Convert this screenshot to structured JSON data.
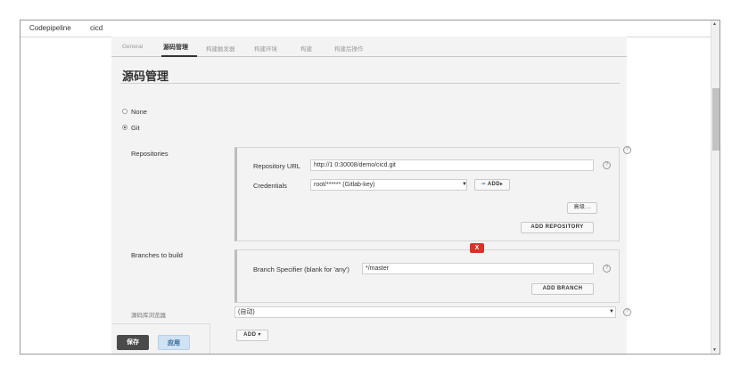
{
  "topbar": {
    "app_name": "Codepipeline",
    "job_name": "cicd"
  },
  "tabs": [
    {
      "label": "General",
      "active": false
    },
    {
      "label": "源码管理",
      "active": true
    },
    {
      "label": "构建触发器",
      "active": false
    },
    {
      "label": "构建环境",
      "active": false
    },
    {
      "label": "构建",
      "active": false
    },
    {
      "label": "构建后操作",
      "active": false
    }
  ],
  "section": {
    "title": "源码管理",
    "radio_none": "None",
    "radio_git": "Git"
  },
  "repositories": {
    "label": "Repositories",
    "url_label": "Repository URL",
    "url_value": "http://1          0:30008/demo/cicd.git",
    "credentials_label": "Credentials",
    "credentials_value": "root/****** (Gitlab-key)",
    "add_label": "ADD",
    "advanced_label": "高级...",
    "add_repository_label": "ADD REPOSITORY",
    "help": "?"
  },
  "branches": {
    "label": "Branches to build",
    "delete_label": "X",
    "specifier_label": "Branch Specifier (blank for 'any')",
    "specifier_value": "*/master",
    "add_branch_label": "ADD BRANCH"
  },
  "browser": {
    "label": "源码库浏览器",
    "value": "(自动)"
  },
  "add_dropdown_label": "ADD",
  "footer": {
    "save_label": "保存",
    "apply_label": "应用"
  },
  "colors": {
    "delete_red": "#d9322a",
    "save_dark": "#4a4a4a",
    "apply_blue": "#cfe3f5"
  }
}
